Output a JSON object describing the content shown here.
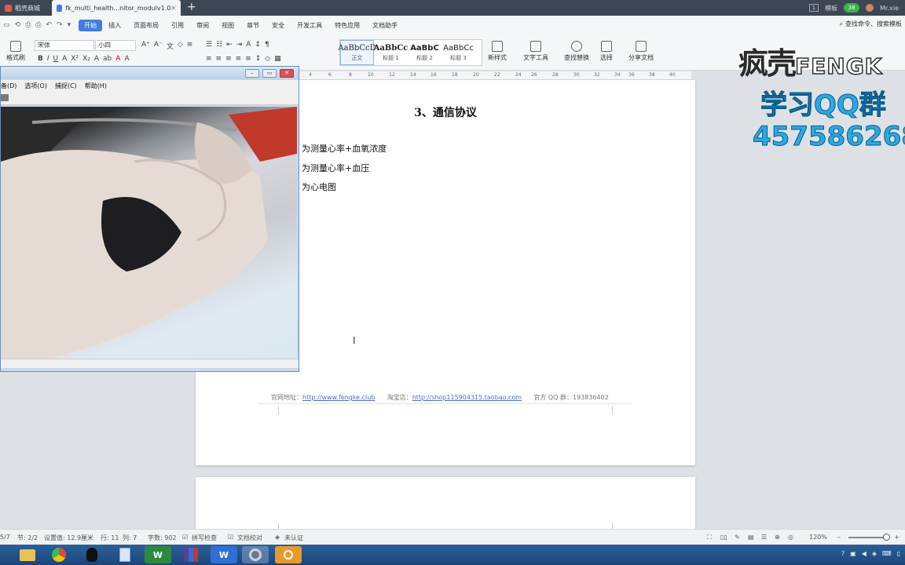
{
  "tabs": [
    {
      "label": "稻壳商城"
    },
    {
      "label": "fk_multi_health...nitor_modulv1.0"
    }
  ],
  "tabbar_right": {
    "template_label": "模板",
    "bubble_count": "38",
    "user_name": "Mr.xie"
  },
  "quick_access": [
    "▭",
    "⟲",
    "⎙",
    "⎙",
    "↶",
    "↷",
    "▾"
  ],
  "menu": {
    "items": [
      "开始",
      "插入",
      "页面布局",
      "引用",
      "审阅",
      "视图",
      "章节",
      "安全",
      "开发工具",
      "特色应用",
      "文档助手"
    ],
    "search_placeholder": "查找命令、搜索模板"
  },
  "ribbon": {
    "format_painter": "格式刷",
    "font_name": "宋体",
    "font_size": "小四",
    "styles": [
      {
        "sample": "AaBbCcD",
        "label": "正文"
      },
      {
        "sample": "AaBbCc",
        "label": "标题 1"
      },
      {
        "sample": "AaBbC",
        "label": "标题 2"
      },
      {
        "sample": "AaBbCc",
        "label": "标题 3"
      }
    ],
    "new_style": "新样式",
    "text_tools": "文字工具",
    "find_replace": "查找替换",
    "select": "选择",
    "share_doc": "分享文档"
  },
  "ruler_numbers": [
    "4",
    "6",
    "8",
    "10",
    "12",
    "14",
    "16",
    "18",
    "20",
    "22",
    "24",
    "26",
    "28",
    "30",
    "32",
    "34",
    "36",
    "38",
    "40"
  ],
  "document": {
    "heading": "3、通信协议",
    "lines": [
      "为测量心率+血氧浓度",
      "为测量心率+血压",
      "为心电图"
    ],
    "footer": {
      "site_label": "官网地址：",
      "site_url": "http://www.fengke.club",
      "shop_label": "淘宝店：",
      "shop_url": "http://shop115904315.taobao.com",
      "qq_label": "官方 QQ 群：193836402"
    }
  },
  "overlay": {
    "logo_cn": "疯壳",
    "logo_en": "FENGK",
    "qq_title": "学习QQ群",
    "qq_number": "457586268"
  },
  "capture_window": {
    "menu": [
      "备(D)",
      "选项(O)",
      "捕捉(C)",
      "帮助(H)"
    ]
  },
  "statusbar": {
    "page": "5/7",
    "section": "节: 2/2",
    "position": "设置值: 12.9厘米",
    "row": "行: 11",
    "col": "列: 7",
    "word_count": "字数: 902",
    "spell_check": "拼写检查",
    "doc_proof": "文档校对",
    "cert": "未认证",
    "zoom": "120%"
  },
  "taskbar": {
    "items": [
      {
        "icon": "folder-icon",
        "color": "#e8c15a"
      },
      {
        "icon": "chrome-icon",
        "color": "#dd4b39"
      },
      {
        "icon": "qq-icon",
        "color": "#111111"
      },
      {
        "icon": "notepad-icon",
        "color": "#7fa7d6"
      },
      {
        "icon": "wps-spreadsheet-icon",
        "color": "#2b8a3e"
      },
      {
        "icon": "winrar-icon",
        "color": "#5b3f8c"
      },
      {
        "icon": "wps-writer-icon",
        "color": "#2f6fd6"
      },
      {
        "icon": "webcam-icon",
        "color": "#6a7a8c"
      },
      {
        "icon": "app-icon",
        "color": "#e89a2a"
      }
    ],
    "taskbar_labels": [
      "W",
      "W"
    ]
  },
  "colors": {
    "accent": "#3f7de0",
    "qq_cyan": "#2aa9e0"
  }
}
